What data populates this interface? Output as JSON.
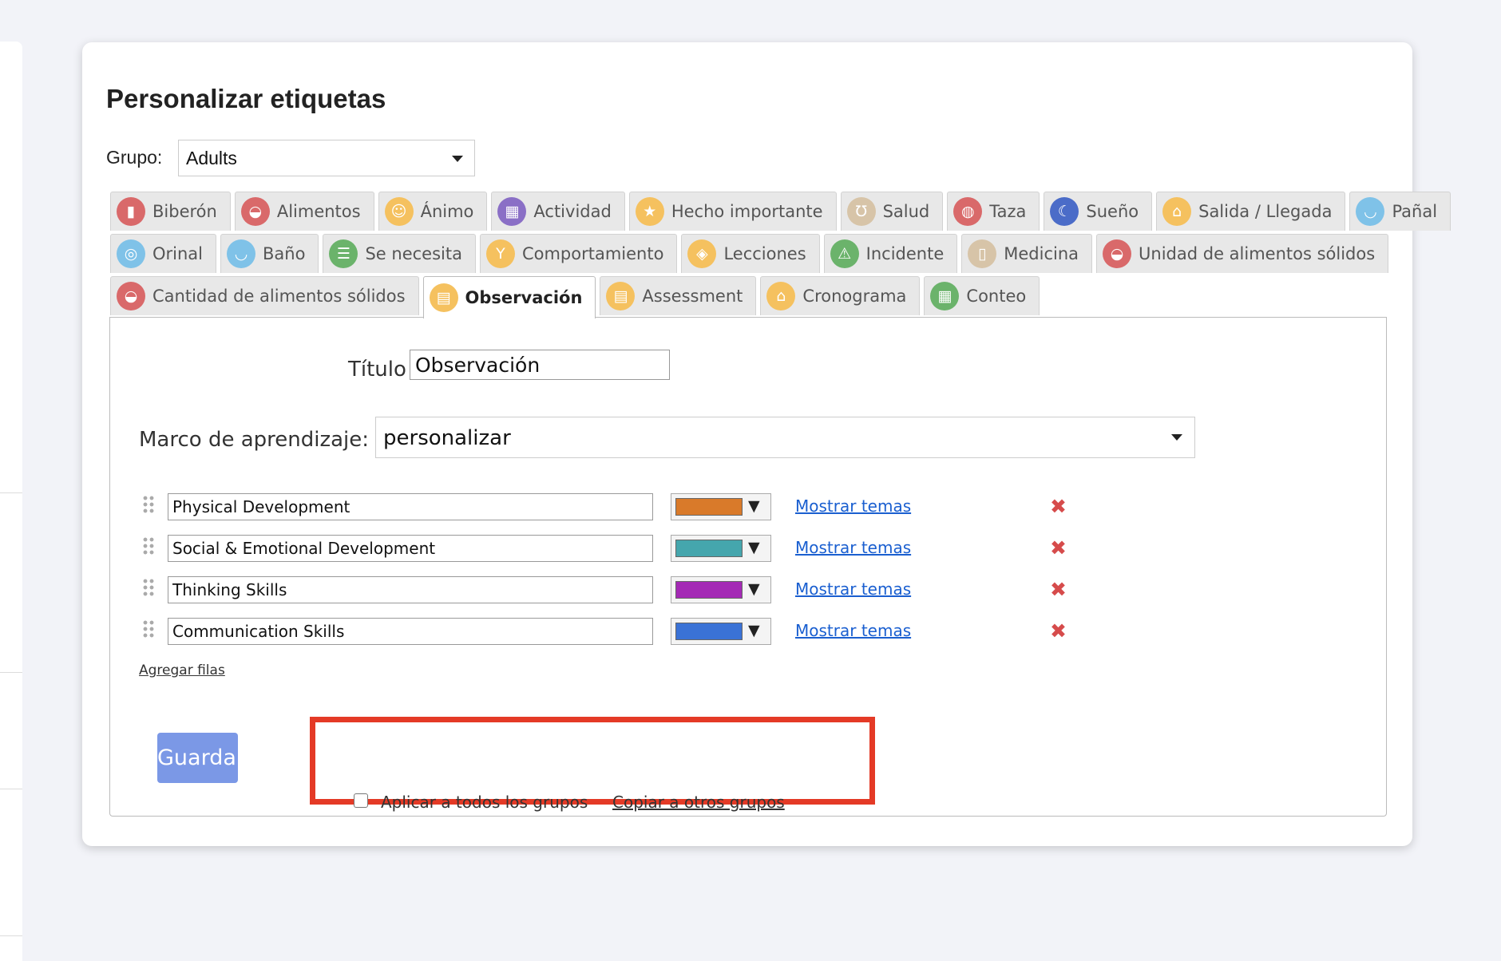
{
  "page": {
    "title": "Personalizar etiquetas",
    "group_label": "Grupo:",
    "group_value": "Adults"
  },
  "tabs": {
    "rows": [
      [
        {
          "label": "Biberón",
          "icon": "baby-bottle-icon",
          "glyph": "▮",
          "color": "#d9696a"
        },
        {
          "label": "Alimentos",
          "icon": "food-bowl-icon",
          "glyph": "◒",
          "color": "#d9696a"
        },
        {
          "label": "Ánimo",
          "icon": "mood-face-icon",
          "glyph": "☺",
          "color": "#f5c15f"
        },
        {
          "label": "Actividad",
          "icon": "activity-blocks-icon",
          "glyph": "▦",
          "color": "#8a6fc6"
        },
        {
          "label": "Hecho importante",
          "icon": "star-icon",
          "glyph": "★",
          "color": "#f5c15f"
        },
        {
          "label": "Salud",
          "icon": "stethoscope-icon",
          "glyph": "℧",
          "color": "#d7c4a8"
        },
        {
          "label": "Taza",
          "icon": "sippy-cup-icon",
          "glyph": "◍",
          "color": "#d9696a"
        },
        {
          "label": "Sueño",
          "icon": "moon-icon",
          "glyph": "☾",
          "color": "#4b6cc8"
        },
        {
          "label": "Salida / Llegada",
          "icon": "house-icon",
          "glyph": "⌂",
          "color": "#f5c15f"
        },
        {
          "label": "Pañal",
          "icon": "diaper-icon",
          "glyph": "◡",
          "color": "#7fc2e8"
        }
      ],
      [
        {
          "label": "Orinal",
          "icon": "potty-icon",
          "glyph": "◎",
          "color": "#7fc2e8"
        },
        {
          "label": "Baño",
          "icon": "bathtub-icon",
          "glyph": "◡",
          "color": "#7fc2e8"
        },
        {
          "label": "Se necesita",
          "icon": "checklist-icon",
          "glyph": "☰",
          "color": "#6bb36b"
        },
        {
          "label": "Comportamiento",
          "icon": "medal-icon",
          "glyph": "Y",
          "color": "#f5c15f"
        },
        {
          "label": "Lecciones",
          "icon": "book-icon",
          "glyph": "◈",
          "color": "#f5c15f"
        },
        {
          "label": "Incidente",
          "icon": "warning-icon",
          "glyph": "⚠",
          "color": "#6bb36b"
        },
        {
          "label": "Medicina",
          "icon": "medicine-bottle-icon",
          "glyph": "▯",
          "color": "#d7c4a8"
        },
        {
          "label": "Unidad de alimentos sólidos",
          "icon": "food-bowl-icon",
          "glyph": "◒",
          "color": "#d9696a"
        }
      ],
      [
        {
          "label": "Cantidad de alimentos sólidos",
          "icon": "food-bowl-icon",
          "glyph": "◒",
          "color": "#d9696a"
        },
        {
          "label": "Observación",
          "icon": "note-icon",
          "glyph": "▤",
          "color": "#f5c15f",
          "active": true
        },
        {
          "label": "Assessment",
          "icon": "note-icon",
          "glyph": "▤",
          "color": "#f5c15f"
        },
        {
          "label": "Cronograma",
          "icon": "house-icon",
          "glyph": "⌂",
          "color": "#f5c15f"
        },
        {
          "label": "Conteo",
          "icon": "counter-grid-icon",
          "glyph": "▦",
          "color": "#6bb36b"
        }
      ]
    ]
  },
  "form": {
    "title_label": "Título",
    "title_value": "Observación",
    "framework_label": "Marco de aprendizaje:",
    "framework_value": "personalizar",
    "rows": [
      {
        "value": "Physical Development",
        "color": "#d97a2a",
        "link": "Mostrar temas"
      },
      {
        "value": "Social & Emotional Development",
        "color": "#45a6ad",
        "link": "Mostrar temas"
      },
      {
        "value": "Thinking Skills",
        "color": "#a42ab5",
        "link": "Mostrar temas"
      },
      {
        "value": "Communication Skills",
        "color": "#3a72d6",
        "link": "Mostrar temas"
      }
    ],
    "add_rows": "Agregar filas",
    "save": "Guardar",
    "apply_all": "Aplicar a todos los grupos",
    "copy_groups": "Copiar a otros grupos",
    "highlight_color": "#e43a26"
  }
}
